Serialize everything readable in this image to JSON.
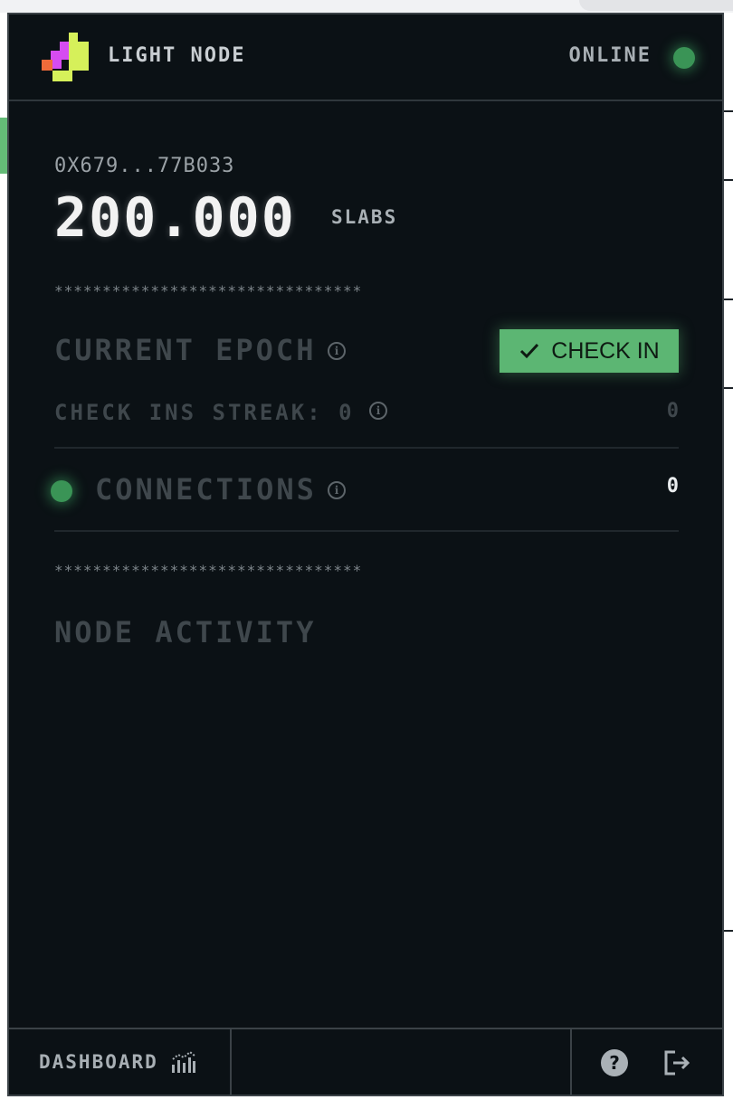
{
  "header": {
    "title": "LIGHT NODE",
    "status": "ONLINE"
  },
  "wallet": {
    "address": "0X679...77B033",
    "balance": "200.000",
    "unit": "SLABS"
  },
  "separator": "********************************",
  "epoch": {
    "title": "CURRENT EPOCH",
    "check_in_label": "CHECK IN",
    "streak_label": "CHECK INS STREAK: 0",
    "streak_value": "0"
  },
  "connections": {
    "title": "CONNECTIONS",
    "count": "0"
  },
  "activity": {
    "title": "NODE ACTIVITY"
  },
  "footer": {
    "dashboard_label": "DASHBOARD",
    "help_label": "?"
  },
  "icons": {
    "logo": "logo-icon",
    "check": "check-icon",
    "info": "info-icon",
    "dashboard": "chart-icon",
    "help": "help-icon",
    "logout": "logout-icon"
  },
  "colors": {
    "background": "#0b1115",
    "accent_green": "#5cb673",
    "status_green": "#3a9456",
    "logo_pink": "#d64cf0",
    "logo_orange": "#f06b3a",
    "logo_lime": "#d6f05a"
  }
}
